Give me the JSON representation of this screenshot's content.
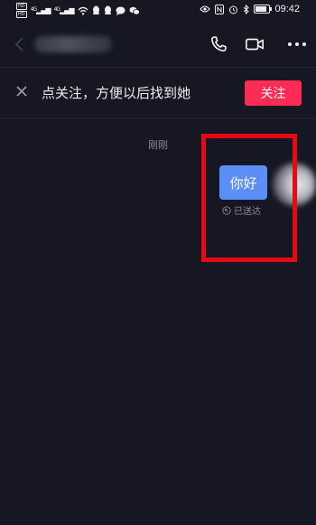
{
  "status_bar": {
    "hd1": "HD",
    "hd2": "HD",
    "net1": "4G",
    "net2": "4G",
    "time": "09:42",
    "battery_level": 0.85
  },
  "header": {
    "contact_name": ""
  },
  "banner": {
    "text": "点关注，方便以后找到她",
    "follow_label": "关注"
  },
  "chat": {
    "timestamp": "刚刚",
    "messages": [
      {
        "text": "你好",
        "status": "已送达"
      }
    ]
  },
  "colors": {
    "background": "#161723",
    "follow_button": "#fe2c55",
    "bubble": "#5b8ef7",
    "highlight": "#e60a12"
  }
}
